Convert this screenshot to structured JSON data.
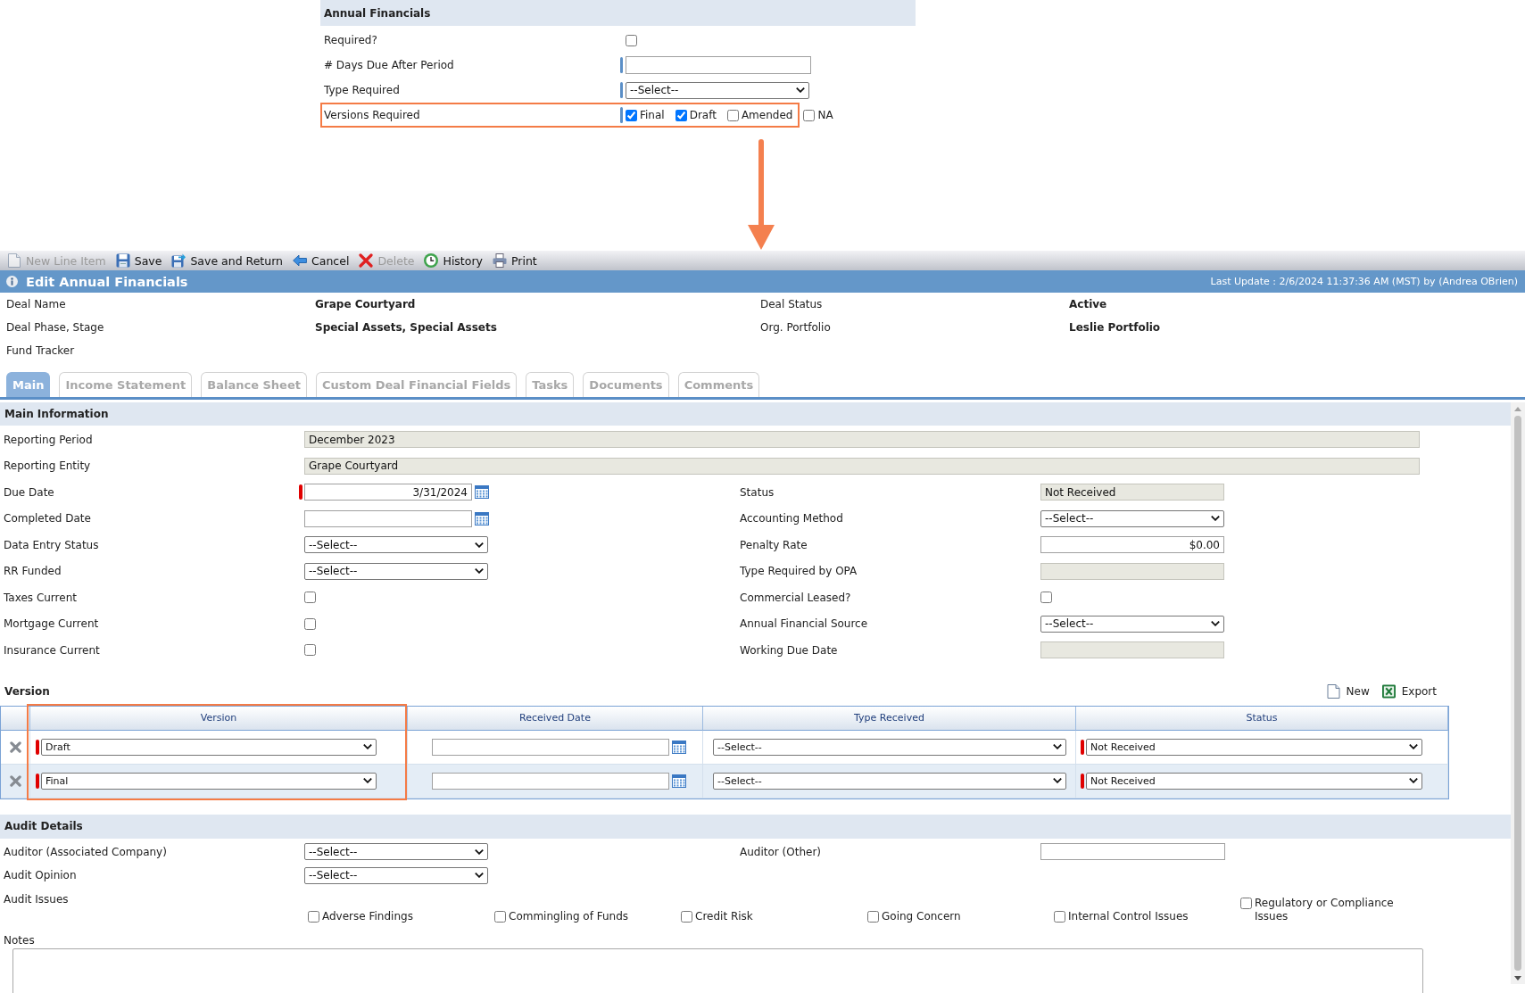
{
  "annual_financials": {
    "title": "Annual Financials",
    "fields": [
      {
        "kind": "checkbox",
        "label": "Required?",
        "checked": false,
        "required": false,
        "highlighted": false
      },
      {
        "kind": "text",
        "label": "# Days Due After Period",
        "required": true,
        "highlighted": false
      },
      {
        "kind": "select",
        "label": "Type Required",
        "value": "--Select--",
        "required": true,
        "highlighted": false
      },
      {
        "kind": "checkgroup",
        "label": "Versions Required",
        "required": true,
        "highlighted": true,
        "options": [
          {
            "label": "Final",
            "checked": true
          },
          {
            "label": "Draft",
            "checked": true
          },
          {
            "label": "Amended",
            "checked": false
          },
          {
            "label": "NA",
            "checked": false
          }
        ]
      }
    ]
  },
  "toolbar": [
    {
      "kind": "new",
      "label": "New Line Item",
      "disabled": true
    },
    {
      "kind": "save",
      "label": "Save",
      "disabled": false
    },
    {
      "kind": "return",
      "label": "Save and Return",
      "disabled": false
    },
    {
      "kind": "cancel",
      "label": "Cancel",
      "disabled": false
    },
    {
      "kind": "delete",
      "label": "Delete",
      "disabled": true
    },
    {
      "kind": "history",
      "label": "History",
      "disabled": false
    },
    {
      "kind": "print",
      "label": "Print",
      "disabled": false
    }
  ],
  "header": {
    "title": "Edit Annual Financials",
    "last_update": "Last Update : 2/6/2024 11:37:36 AM (MST) by (Andrea OBrien)"
  },
  "deal_info": [
    {
      "label": "Deal Name",
      "value": "Grape Courtyard"
    },
    {
      "label": "Deal Status",
      "value": "Active"
    },
    {
      "label": "Deal Phase, Stage",
      "value": "Special Assets, Special Assets"
    },
    {
      "label": "Org. Portfolio",
      "value": "Leslie Portfolio"
    },
    {
      "label": "Fund Tracker"
    }
  ],
  "tabs": [
    {
      "label": "Main",
      "selected": true
    },
    {
      "label": "Income Statement",
      "selected": false
    },
    {
      "label": "Balance Sheet",
      "selected": false
    },
    {
      "label": "Custom Deal Financial Fields",
      "selected": false
    },
    {
      "label": "Tasks",
      "selected": false
    },
    {
      "label": "Documents",
      "selected": false
    },
    {
      "label": "Comments",
      "selected": false
    }
  ],
  "main_information": {
    "title": "Main Information",
    "wide_fields": [
      {
        "label": "Reporting Period",
        "value": "December 2023"
      },
      {
        "label": "Reporting Entity",
        "value": "Grape Courtyard"
      }
    ],
    "fields": [
      {
        "kind": "date",
        "label": "Due Date",
        "value": "3/31/2024",
        "required": true
      },
      {
        "kind": "readonly",
        "label": "Status",
        "value": "Not Received",
        "required": false
      },
      {
        "kind": "date",
        "label": "Completed Date",
        "required": false
      },
      {
        "kind": "select",
        "label": "Accounting Method",
        "value": "--Select--",
        "required": false
      },
      {
        "kind": "select",
        "label": "Data Entry Status",
        "value": "--Select--",
        "required": false
      },
      {
        "kind": "currency",
        "label": "Penalty Rate",
        "value": "$0.00",
        "required": false
      },
      {
        "kind": "select",
        "label": "RR Funded",
        "value": "--Select--",
        "required": false
      },
      {
        "kind": "readonly",
        "label": "Type Required by OPA",
        "required": false
      },
      {
        "kind": "checkbox",
        "label": "Taxes Current",
        "checked": false,
        "required": false
      },
      {
        "kind": "checkbox",
        "label": "Commercial Leased?",
        "checked": false,
        "required": false
      },
      {
        "kind": "checkbox",
        "label": "Mortgage Current",
        "checked": false,
        "required": false
      },
      {
        "kind": "select",
        "label": "Annual Financial Source",
        "value": "--Select--",
        "required": false
      },
      {
        "kind": "checkbox",
        "label": "Insurance Current",
        "checked": false,
        "required": false
      },
      {
        "kind": "readonly",
        "label": "Working Due Date",
        "required": false
      }
    ]
  },
  "version": {
    "title": "Version",
    "actions": [
      {
        "kind": "new",
        "label": "New"
      },
      {
        "kind": "export",
        "label": "Export"
      }
    ],
    "columns": [
      {
        "label": "Version",
        "highlighted": true
      },
      {
        "label": "Received Date",
        "highlighted": false
      },
      {
        "label": "Type Received",
        "highlighted": false
      },
      {
        "label": "Status",
        "highlighted": false
      }
    ],
    "rows": [
      {
        "cells": [
          {
            "kind": "select",
            "value": "Draft",
            "required": true
          },
          {
            "kind": "date",
            "required": false
          },
          {
            "kind": "select",
            "value": "--Select--",
            "required": false
          },
          {
            "kind": "select",
            "value": "Not Received",
            "required": true
          }
        ]
      },
      {
        "cells": [
          {
            "kind": "select",
            "value": "Final",
            "required": true
          },
          {
            "kind": "date",
            "required": false
          },
          {
            "kind": "select",
            "value": "--Select--",
            "required": false
          },
          {
            "kind": "select",
            "value": "Not Received",
            "required": true
          }
        ]
      }
    ]
  },
  "audit_details": {
    "title": "Audit Details",
    "fields": [
      {
        "kind": "select",
        "label": "Auditor (Associated Company)",
        "value": "--Select--"
      },
      {
        "kind": "text",
        "label": "Auditor (Other)"
      },
      {
        "kind": "select",
        "label": "Audit Opinion",
        "value": "--Select--"
      }
    ],
    "issues": {
      "label": "Audit Issues",
      "options": [
        {
          "label": "Adverse Findings",
          "checked": false
        },
        {
          "label": "Commingling of Funds",
          "checked": false
        },
        {
          "label": "Credit Risk",
          "checked": false
        },
        {
          "label": "Going Concern",
          "checked": false
        },
        {
          "label": "Internal Control Issues",
          "checked": false
        },
        {
          "label": "Regulatory or Compliance Issues",
          "checked": false
        }
      ]
    },
    "notes": {
      "label": "Notes"
    }
  }
}
